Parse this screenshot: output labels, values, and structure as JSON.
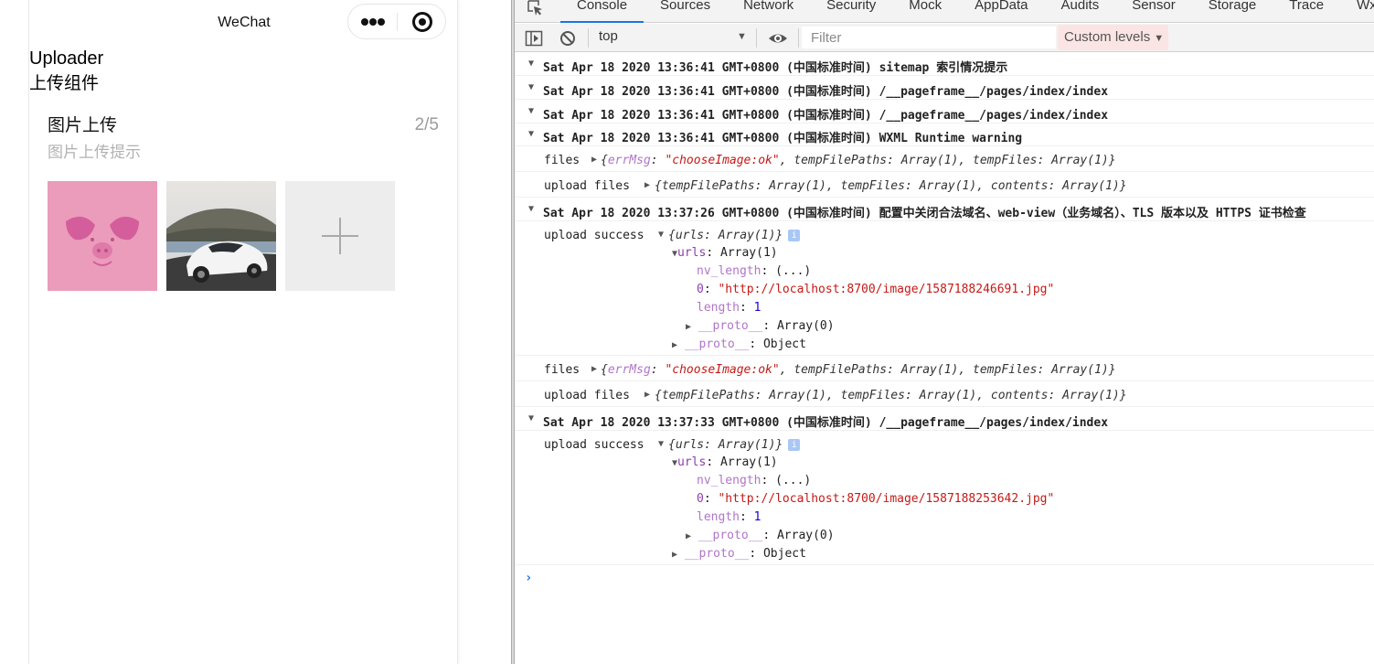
{
  "simulator": {
    "nav_title": "WeChat",
    "page_title": "Uploader",
    "page_desc": "上传组件",
    "uploader": {
      "title": "图片上传",
      "count": "2/5",
      "tip": "图片上传提示"
    },
    "colors": {
      "pig_bg": "#eb9cba",
      "pig_fg": "#d45e9b",
      "add_tile_bg": "#ededed"
    }
  },
  "devtools": {
    "tabs": [
      "Console",
      "Sources",
      "Network",
      "Security",
      "Mock",
      "AppData",
      "Audits",
      "Sensor",
      "Storage",
      "Trace",
      "Wxml"
    ],
    "active_tab": "Console",
    "context": "top",
    "filter_placeholder": "Filter",
    "levels_label": "Custom levels",
    "groups": [
      "Sat Apr 18 2020 13:36:41 GMT+0800 (中国标准时间) sitemap 索引情况提示",
      "Sat Apr 18 2020 13:36:41 GMT+0800 (中国标准时间) /__pageframe__/pages/index/index",
      "Sat Apr 18 2020 13:36:41 GMT+0800 (中国标准时间) /__pageframe__/pages/index/index",
      "Sat Apr 18 2020 13:36:41 GMT+0800 (中国标准时间) WXML Runtime warning",
      "Sat Apr 18 2020 13:37:26 GMT+0800 (中国标准时间) 配置中关闭合法域名、web-view（业务域名）、TLS 版本以及 HTTPS 证书检查",
      "Sat Apr 18 2020 13:37:33 GMT+0800 (中国标准时间) /__pageframe__/pages/index/index"
    ],
    "logs": {
      "files_label": "files",
      "upload_files_label": "upload files",
      "upload_success_label": "upload success",
      "err_key": "errMsg",
      "err_value": "\"chooseImage:ok\"",
      "temp_paths": "tempFilePaths: Array(1)",
      "temp_files": "tempFiles: Array(1)",
      "contents": "contents: Array(1)",
      "urls_summary": "urls: Array(1)",
      "urls_key": "urls",
      "array1": "Array(1)",
      "nv_length_key": "nv_length",
      "nv_length_val": "(...)",
      "index0": "0",
      "url1": "\"http://localhost:8700/image/1587188246691.jpg\"",
      "url2": "\"http://localhost:8700/image/1587188253642.jpg\"",
      "length_key": "length",
      "length_val": "1",
      "proto_key": "__proto__",
      "proto_array": "Array(0)",
      "proto_object": "Object"
    },
    "colors": {
      "accent": "#1a73e8",
      "string": "#c41a16",
      "property": "#8c3dab",
      "number": "#1c00cf",
      "levels_bg": "#fbe5e4"
    }
  }
}
